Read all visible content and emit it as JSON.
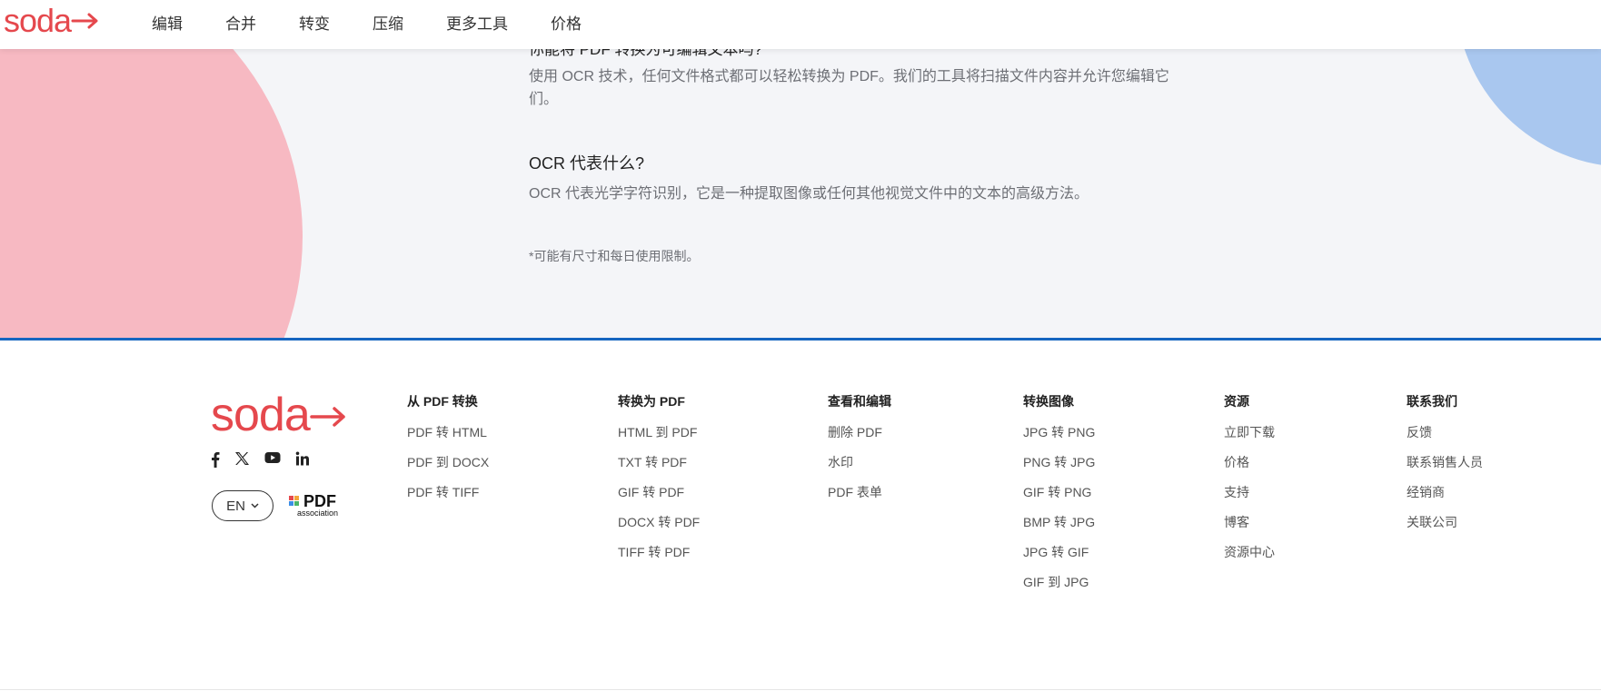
{
  "nav": {
    "logo": "soda",
    "items": [
      "编辑",
      "合并",
      "转变",
      "压缩",
      "更多工具",
      "价格"
    ]
  },
  "faq": {
    "q1_partial": "你能将 PDF 转换为可编辑文本吗?",
    "a1": "使用 OCR 技术，任何文件格式都可以轻松转换为 PDF。我们的工具将扫描文件内容并允许您编辑它们。",
    "q2": "OCR 代表什么?",
    "a2": "OCR 代表光学字符识别，它是一种提取图像或任何其他视觉文件中的文本的高级方法。",
    "note": "*可能有尺寸和每日使用限制。"
  },
  "footer": {
    "logo": "soda",
    "social": [
      "facebook-icon",
      "x-icon",
      "youtube-icon",
      "linkedin-icon"
    ],
    "language": "EN",
    "pdf_assoc": {
      "pdf": "PDF",
      "sub": "association"
    },
    "columns": [
      {
        "title": "从 PDF 转换",
        "links": [
          "PDF 转 HTML",
          "PDF 到 DOCX",
          "PDF 转 TIFF"
        ]
      },
      {
        "title": "转换为 PDF",
        "links": [
          "HTML 到 PDF",
          "TXT 转 PDF",
          "GIF 转 PDF",
          "DOCX 转 PDF",
          "TIFF 转 PDF"
        ]
      },
      {
        "title": "查看和编辑",
        "links": [
          "删除 PDF",
          "水印",
          "PDF 表单"
        ]
      },
      {
        "title": "转换图像",
        "links": [
          "JPG 转 PNG",
          "PNG 转 JPG",
          "GIF 转 PNG",
          "BMP 转 JPG",
          "JPG 转 GIF",
          "GIF 到 JPG"
        ]
      },
      {
        "title": "资源",
        "links": [
          "立即下载",
          "价格",
          "支持",
          "博客",
          "资源中心"
        ]
      },
      {
        "title": "联系我们",
        "links": [
          "反馈",
          "联系销售人员",
          "经销商",
          "关联公司"
        ]
      }
    ]
  },
  "colors": {
    "brand": "#e5484d",
    "pink": "#f7b9c2",
    "blue": "#a9c7ef",
    "divider": "#1565c0"
  }
}
